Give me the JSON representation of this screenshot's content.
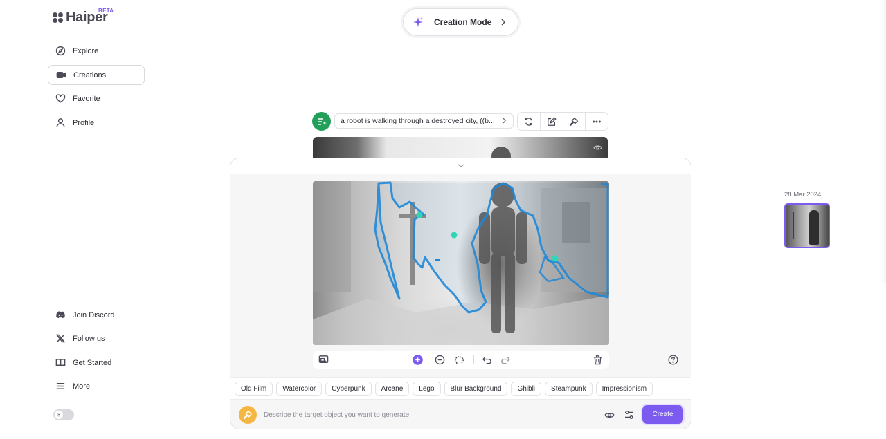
{
  "brand": {
    "name": "Haiper",
    "badge": "BETA"
  },
  "nav": {
    "top": [
      {
        "label": "Explore",
        "icon": "compass-icon",
        "active": false
      },
      {
        "label": "Creations",
        "icon": "video-camera-icon",
        "active": true
      },
      {
        "label": "Favorite",
        "icon": "heart-icon",
        "active": false
      },
      {
        "label": "Profile",
        "icon": "user-icon",
        "active": false
      }
    ],
    "bottom": [
      {
        "label": "Join Discord",
        "icon": "discord-icon"
      },
      {
        "label": "Follow us",
        "icon": "x-logo-icon"
      },
      {
        "label": "Get Started",
        "icon": "book-icon"
      },
      {
        "label": "More",
        "icon": "menu-icon"
      }
    ]
  },
  "mode": {
    "label": "Creation Mode"
  },
  "prompt": {
    "text": "a robot is walking through a destroyed city, ((b..."
  },
  "styles": [
    "Old Film",
    "Watercolor",
    "Cyberpunk",
    "Arcane",
    "Lego",
    "Blur Background",
    "Ghibli",
    "Steampunk",
    "Impressionism"
  ],
  "input": {
    "placeholder": "Describe the target object you want to generate"
  },
  "actions": {
    "create": "Create"
  },
  "history": {
    "date": "28 Mar 2024"
  },
  "colors": {
    "accent": "#7c5cf0",
    "prompt_badge": "#22a05b",
    "brush_badge": "#f5b743",
    "mask_outline": "#1e88d8",
    "mask_point": "#2fd6b5"
  }
}
